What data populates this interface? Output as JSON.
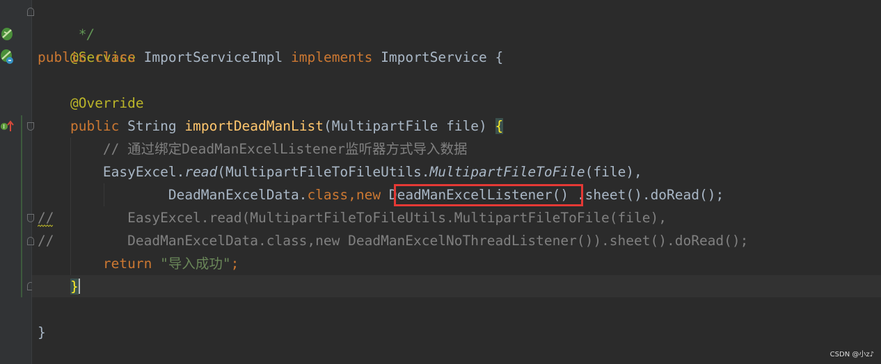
{
  "code": {
    "l1_doc_end": " */",
    "l2_annotation": "@Service",
    "l3_public": "public",
    "l3_class": "class",
    "l3_name": "ImportServiceImpl",
    "l3_implements": "implements",
    "l3_iface": "ImportService {",
    "l5_annotation": "@Override",
    "l6_public": "public",
    "l6_type": "String",
    "l6_method": "importDeadManList",
    "l6_params": "(MultipartFile file)",
    "l6_brace": "{",
    "l7_comment": "// 通过绑定DeadManExcelListener监听器方式导入数据",
    "l8_easyexcel": "EasyExcel.",
    "l8_read": "read",
    "l8_open": "(MultipartFileToFileUtils.",
    "l8_method": "MultipartFileToFile",
    "l8_close": "(file),",
    "l9_data": "DeadManExcelData.",
    "l9_class": "class",
    "l9_comma": ",",
    "l9_new": "new",
    "l9_listener": "DeadManExcelListener()",
    "l9_rest": ".sheet().doRead();",
    "l10_comment": "//         EasyExcel.read(MultipartFileToFileUtils.MultipartFileToFile(file),",
    "l11_comment": "//         DeadManExcelData.class,new DeadManExcelNoThreadListener()).sheet().doRead();",
    "l12_return": "return",
    "l12_string": "\"导入成功\"",
    "l12_semi": ";",
    "l13_brace": "}",
    "l15_brace": "}"
  },
  "watermark": "CSDN @小z♪",
  "colors": {
    "background": "#2b2b2b",
    "keyword": "#cc7832",
    "annotation": "#bbb529",
    "method": "#ffc66d",
    "string": "#6a8759",
    "comment": "#808080",
    "highlight_box": "#e53935"
  }
}
